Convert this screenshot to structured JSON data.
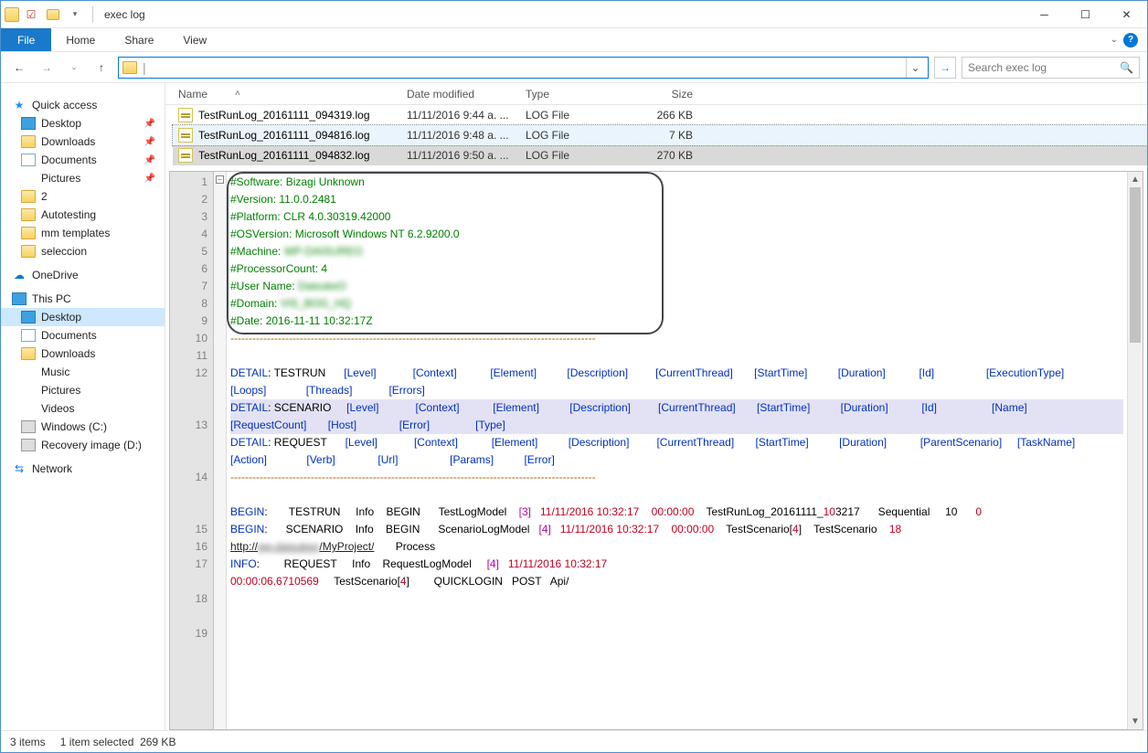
{
  "window": {
    "title": "exec log"
  },
  "ribbon": {
    "file": "File",
    "tabs": [
      "Home",
      "Share",
      "View"
    ]
  },
  "nav": {
    "search_placeholder": "Search exec log"
  },
  "sidebar": {
    "quick": {
      "label": "Quick access",
      "items": [
        {
          "label": "Desktop",
          "pinned": true,
          "ico": "desktop"
        },
        {
          "label": "Downloads",
          "pinned": true,
          "ico": "folder"
        },
        {
          "label": "Documents",
          "pinned": true,
          "ico": "doc"
        },
        {
          "label": "Pictures",
          "pinned": true,
          "ico": "pic"
        },
        {
          "label": "2",
          "pinned": false,
          "ico": "folder"
        },
        {
          "label": "Autotesting",
          "pinned": false,
          "ico": "folder"
        },
        {
          "label": "mm templates",
          "pinned": false,
          "ico": "folder"
        },
        {
          "label": "seleccion",
          "pinned": false,
          "ico": "folder"
        }
      ]
    },
    "onedrive": {
      "label": "OneDrive"
    },
    "thispc": {
      "label": "This PC",
      "items": [
        {
          "label": "Desktop",
          "ico": "desktop",
          "selected": true
        },
        {
          "label": "Documents",
          "ico": "doc"
        },
        {
          "label": "Downloads",
          "ico": "folder"
        },
        {
          "label": "Music",
          "ico": "music"
        },
        {
          "label": "Pictures",
          "ico": "pic"
        },
        {
          "label": "Videos",
          "ico": "video"
        },
        {
          "label": "Windows (C:)",
          "ico": "drive"
        },
        {
          "label": "Recovery image (D:)",
          "ico": "drive"
        }
      ]
    },
    "network": {
      "label": "Network"
    }
  },
  "columns": {
    "name": "Name",
    "date": "Date modified",
    "type": "Type",
    "size": "Size"
  },
  "files": [
    {
      "name": "TestRunLog_20161111_094319.log",
      "date": "11/11/2016 9:44 a. ...",
      "type": "LOG File",
      "size": "266 KB",
      "state": ""
    },
    {
      "name": "TestRunLog_20161111_094816.log",
      "date": "11/11/2016 9:48 a. ...",
      "type": "LOG File",
      "size": "7 KB",
      "state": "dotsel"
    },
    {
      "name": "TestRunLog_20161111_094832.log",
      "date": "11/11/2016 9:50 a. ...",
      "type": "LOG File",
      "size": "270 KB",
      "state": "sel"
    }
  ],
  "status": {
    "items": "3 items",
    "selected": "1 item selected",
    "size": "269 KB"
  },
  "editor": {
    "header": [
      "#Software: Bizagi Unknown",
      "#Version: 11.0.0.2481",
      "#Platform: CLR 4.0.30319.42000",
      "#OSVersion: Microsoft Windows NT 6.2.9200.0",
      "#Machine: WP-DAISUREO",
      "#ProcessorCount: 4",
      "#User Name: DaisukeO",
      "#Domain: VIS_BOG_HQ",
      "#Date: 2016-11-11 10:32:17Z"
    ],
    "lines": {
      "testrun": "DETAIL: TESTRUN      [Level]            [Context]           [Element]          [Description]         [CurrentThread]       [StartTime]          [Duration]           [Id]                 [ExecutionType]        [Loops]             [Threads]            [Errors]",
      "scenario": "DETAIL: SCENARIO     [Level]            [Context]           [Element]          [Description]         [CurrentThread]       [StartTime]          [Duration]           [Id]                  [Name]               [RequestCount]       [Host]              [Error]               [Type]",
      "request": "DETAIL: REQUEST      [Level]            [Context]           [Element]          [Description]         [CurrentThread]       [StartTime]          [Duration]           [ParentScenario]     [TaskName]            [Action]             [Verb]              [Url]                 [Params]          [Error]"
    },
    "begin_testrun": {
      "prefix": "BEGIN:       TESTRUN     Info    BEGIN      TestLogModel    ",
      "thread": "[3]",
      "time": "   11/11/2016 10:32:17",
      "dur": "    00:00:00",
      "rest": "    TestRunLog_20161111_103217      Sequential     10      0"
    },
    "begin_scenario": {
      "prefix": "BEGIN:      SCENARIO    Info    BEGIN      ScenarioLogModel   ",
      "thread": "[4]",
      "time": "   11/11/2016 10:32:17",
      "dur": "    00:00:00",
      "rest": "    TestScenario[4]    TestScenario    18",
      "url_a": "http://",
      "url_b": "wp-daisukeo",
      "url_c": "/MyProject/",
      "tail": "       Process"
    },
    "info_request": {
      "prefix": "INFO:        REQUEST     Info    RequestLogModel     ",
      "thread": "[4]",
      "time": "   11/11/2016 10:32:17",
      "dur": "00:00:06.6710569",
      "rest": "     TestScenario[4]        QUICKLOGIN   POST   Api/"
    }
  }
}
